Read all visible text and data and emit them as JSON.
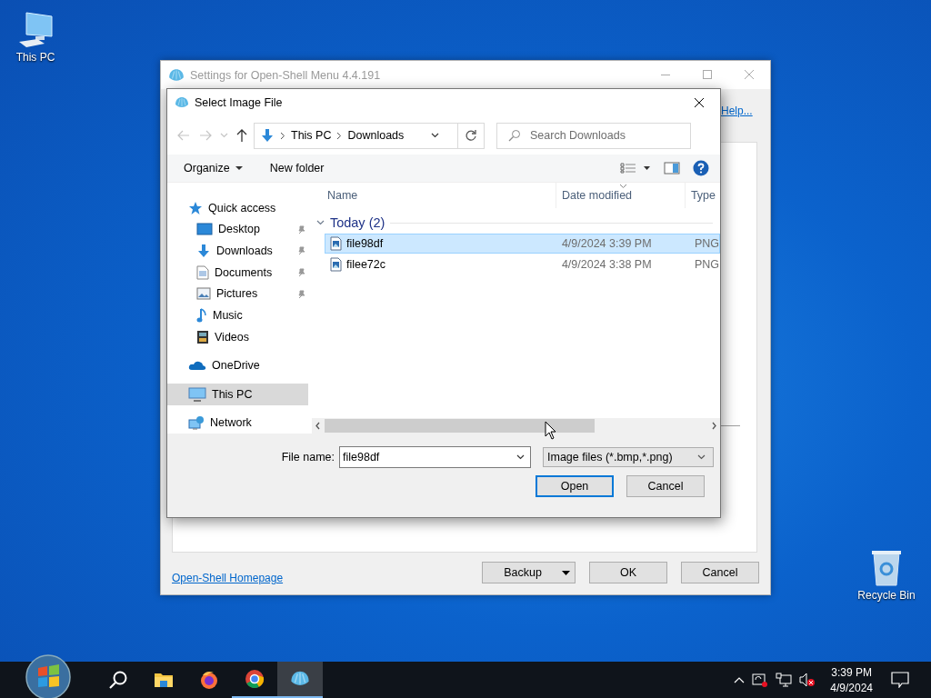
{
  "desktop_icons": [
    {
      "label": "This PC"
    },
    {
      "label": "Recycle Bin"
    }
  ],
  "settings_window": {
    "title": "Settings for Open-Shell Menu 4.4.191",
    "help_link": "Help...",
    "homepage_link": "Open-Shell Homepage",
    "buttons": [
      {
        "label": "Backup",
        "kind": "split"
      },
      {
        "label": "OK",
        "kind": "plain"
      },
      {
        "label": "Cancel",
        "kind": "plain"
      }
    ]
  },
  "dialog": {
    "title": "Select Image File",
    "breadcrumb": [
      "This PC",
      "Downloads"
    ],
    "search": {
      "placeholder": "Search Downloads"
    },
    "toolbar": [
      "Organize",
      "New folder"
    ],
    "nav": [
      {
        "label": "Quick access",
        "selected": false,
        "children": [
          {
            "label": "Desktop",
            "selected": false,
            "pinned": true
          },
          {
            "label": "Downloads",
            "selected": false,
            "pinned": true
          },
          {
            "label": "Documents",
            "selected": false,
            "pinned": true
          },
          {
            "label": "Pictures",
            "selected": false,
            "pinned": true
          },
          {
            "label": "Music",
            "selected": false,
            "pinned": false
          },
          {
            "label": "Videos",
            "selected": false,
            "pinned": false
          }
        ]
      },
      {
        "label": "OneDrive",
        "selected": false
      },
      {
        "label": "This PC",
        "selected": true
      },
      {
        "label": "Network",
        "selected": false
      }
    ],
    "columns": [
      "Name",
      "Date modified",
      "Type"
    ],
    "group": "Today (2)",
    "files": [
      {
        "name": "file98df",
        "date": "4/9/2024 3:39 PM",
        "type": "PNG",
        "selected": true
      },
      {
        "name": "filee72c",
        "date": "4/9/2024 3:38 PM",
        "type": "PNG",
        "selected": false
      }
    ],
    "file_name_label": "File name:",
    "file_name": "file98df",
    "file_type": "Image files (*.bmp,*.png)",
    "buttons": [
      {
        "label": "Open",
        "default": true
      },
      {
        "label": "Cancel",
        "default": false
      }
    ]
  },
  "taskbar": {
    "apps": [
      {
        "kind": "start"
      },
      {
        "kind": "search",
        "running": false,
        "active": false
      },
      {
        "kind": "explorer",
        "running": false,
        "active": false
      },
      {
        "kind": "firefox",
        "running": false,
        "active": false
      },
      {
        "kind": "chrome",
        "running": true,
        "active": false
      },
      {
        "kind": "shell",
        "running": true,
        "active": true
      }
    ],
    "volume_muted": true,
    "time": "3:39 PM",
    "date": "4/9/2024"
  }
}
